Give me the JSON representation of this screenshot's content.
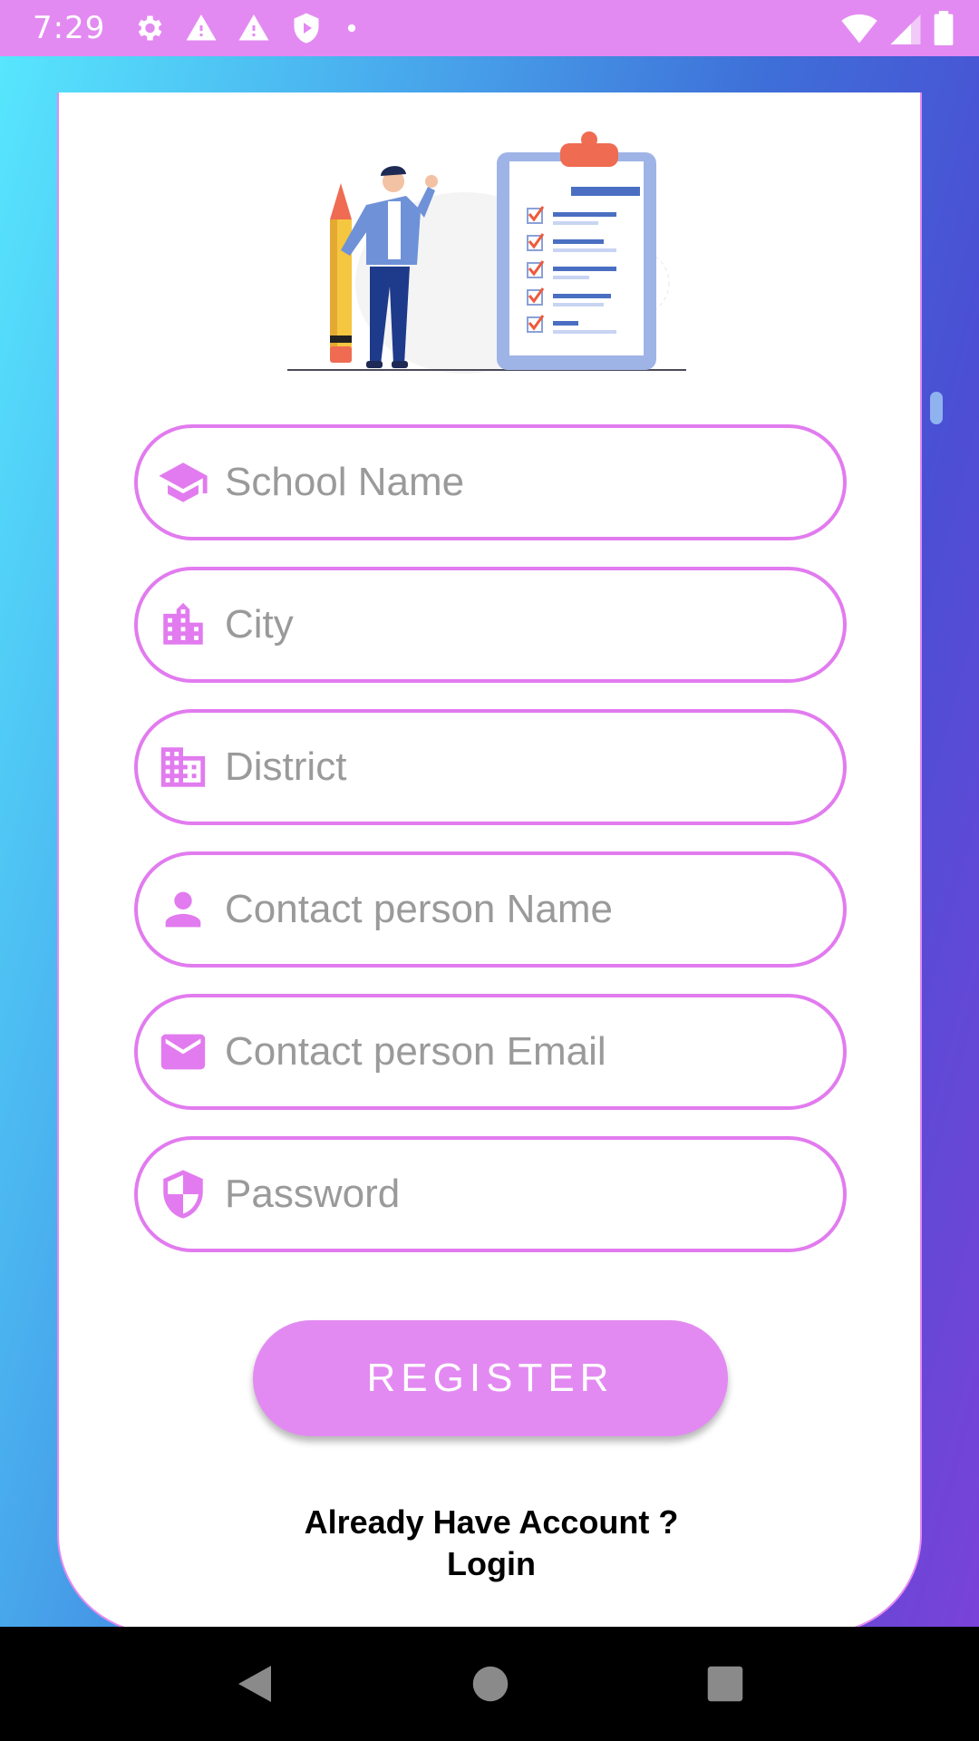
{
  "status_bar": {
    "time": "7:29",
    "icons_left": [
      "settings-icon",
      "warning-icon",
      "warning-icon",
      "shield-play-icon",
      "dot-icon"
    ],
    "icons_right": [
      "wifi-icon",
      "signal-icon",
      "battery-icon"
    ]
  },
  "form": {
    "fields": [
      {
        "name": "school-name",
        "icon": "graduation-cap-icon",
        "placeholder": "School Name",
        "value": ""
      },
      {
        "name": "city",
        "icon": "city-icon",
        "placeholder": "City",
        "value": ""
      },
      {
        "name": "district",
        "icon": "building-icon",
        "placeholder": "District",
        "value": ""
      },
      {
        "name": "contact-person-name",
        "icon": "person-icon",
        "placeholder": "Contact person Name",
        "value": ""
      },
      {
        "name": "contact-person-email",
        "icon": "email-icon",
        "placeholder": "Contact person Email",
        "value": ""
      },
      {
        "name": "password",
        "icon": "shield-icon",
        "placeholder": "Password",
        "value": ""
      }
    ],
    "register_label": "REGISTER",
    "login_prompt": "Already Have Account ?",
    "login_link": "Login"
  },
  "colors": {
    "accent": "#e38af2",
    "field_border": "#e27bef",
    "placeholder": "#9a9a9a"
  },
  "nav_bar": {
    "icons": [
      "back-icon",
      "home-icon",
      "recents-icon"
    ]
  }
}
